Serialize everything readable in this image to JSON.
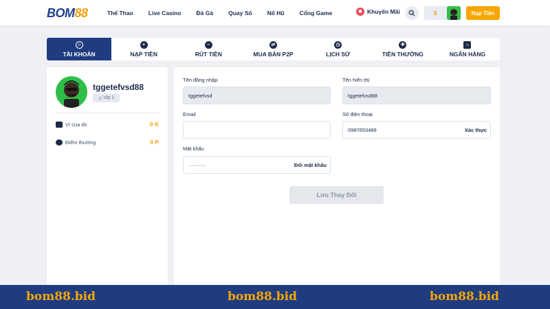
{
  "header": {
    "logo_part1": "BOM",
    "logo_part2": "88",
    "nav": [
      "Thể Thao",
      "Live Casino",
      "Đá Gà",
      "Quay Số",
      "Nổ Hũ",
      "Cổng Game"
    ],
    "promo_label": "Khuyến Mãi",
    "balance": "0",
    "deposit_label": "Nạp Tiền"
  },
  "tabs": [
    {
      "label": "TÀI KHOẢN",
      "icon": "user-icon"
    },
    {
      "label": "NẠP TIỀN",
      "icon": "plus-icon"
    },
    {
      "label": "RÚT TIỀN",
      "icon": "minus-icon"
    },
    {
      "label": "MUA BÁN P2P",
      "icon": "exchange-icon"
    },
    {
      "label": "LỊCH SỬ",
      "icon": "clock-icon"
    },
    {
      "label": "TIỀN THƯỞNG",
      "icon": "gift-icon"
    },
    {
      "label": "NGÂN HÀNG",
      "icon": "bank-icon"
    }
  ],
  "profile": {
    "username": "tggetefvsd88",
    "vip": "Vip 1",
    "wallet_label": "Ví của tôi",
    "wallet_value": "0 K",
    "points_label": "Điểm thưởng",
    "points_value": "0 P"
  },
  "form": {
    "login_name_label": "Tên đăng nhập",
    "login_name_value": "tggetefvsd",
    "display_name_label": "Tên hiển thị",
    "display_name_value": "tggetefvsd88",
    "email_label": "Email",
    "email_value": "",
    "phone_label": "Số điện thoại",
    "phone_value": "0987653489",
    "phone_action": "Xác thực",
    "password_label": "Mật khẩu",
    "password_value": "··········",
    "password_action": "Đổi mật khẩu",
    "save_label": "Lưu Thay Đổi"
  },
  "footer": {
    "texts": [
      "bom88.bid",
      "bom88.bid",
      "bom88.bid"
    ]
  },
  "colors": {
    "brand_blue": "#1f3c80",
    "accent_orange": "#f7a600"
  }
}
